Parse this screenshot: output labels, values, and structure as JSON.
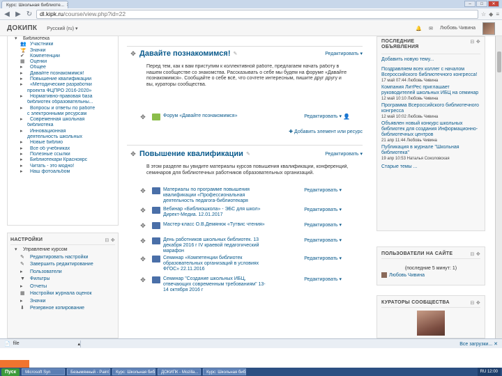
{
  "browser": {
    "tab_title": "Курс: Школьная библиоте...",
    "address_domain": "dl.kipk.ru",
    "address_path": "/course/view.php?id=22",
    "back_icon": "back-arrow-icon",
    "forward_icon": "forward-arrow-icon",
    "reload_icon": "reload-icon"
  },
  "header": {
    "brand": "ДОКИПК",
    "language": "Русский (ru) ▾",
    "user_name": "Любовь Чивина"
  },
  "nav": {
    "items": [
      {
        "label": "Библиотека",
        "level": "top",
        "icon": "▾"
      },
      {
        "label": "Участники",
        "level": "child",
        "icon": "👥"
      },
      {
        "label": "Значки",
        "level": "child",
        "icon": "🏆"
      },
      {
        "label": "Компетенции",
        "level": "child",
        "icon": "✔"
      },
      {
        "label": "Оценки",
        "level": "child",
        "icon": "▦"
      },
      {
        "label": "Общее",
        "level": "child",
        "icon": "▸"
      },
      {
        "label": "Давайте познакомимся!",
        "level": "child",
        "icon": "▸"
      },
      {
        "label": "Повышение квалификации",
        "level": "child",
        "icon": "▸"
      },
      {
        "label": "«Методические разработки",
        "level": "child",
        "icon": "▸"
      },
      {
        "label": "проекта ФЦПРО 2016-2020»",
        "level": "sub",
        "icon": ""
      },
      {
        "label": "Нормативно-правовая база",
        "level": "child",
        "icon": "▸"
      },
      {
        "label": "библиотек образовательны...",
        "level": "sub",
        "icon": ""
      },
      {
        "label": "Вопросы и ответы по работе",
        "level": "child",
        "icon": "▸"
      },
      {
        "label": "с электронными ресурсам",
        "level": "sub",
        "icon": ""
      },
      {
        "label": "Современная школьная",
        "level": "child",
        "icon": "▸"
      },
      {
        "label": "библиотека",
        "level": "sub",
        "icon": ""
      },
      {
        "label": "Инновационная",
        "level": "child",
        "icon": "▸"
      },
      {
        "label": "деятельность школьных",
        "level": "sub",
        "icon": ""
      },
      {
        "label": "Новые библио",
        "level": "child",
        "icon": "▸"
      },
      {
        "label": "Все об учебниках",
        "level": "child",
        "icon": "▸"
      },
      {
        "label": "Полезные ссылки",
        "level": "child",
        "icon": "▸"
      },
      {
        "label": "Библиотекари Красноярс",
        "level": "child",
        "icon": "▸"
      },
      {
        "label": "Читать - это модно!",
        "level": "child",
        "icon": "▸"
      },
      {
        "label": "Наш фотоальбом",
        "level": "child",
        "icon": "▸"
      }
    ]
  },
  "settings": {
    "title": "НАСТРОЙКИ",
    "controls": "⊟ ✥",
    "items": [
      {
        "label": "Управление курсом",
        "icon": "▾",
        "level": "top"
      },
      {
        "label": "Редактировать настройки",
        "icon": "✎",
        "level": "child"
      },
      {
        "label": "Завершить редактирование",
        "icon": "✎",
        "level": "child"
      },
      {
        "label": "Пользователи",
        "icon": "▸",
        "level": "child"
      },
      {
        "label": "Фильтры",
        "icon": "▼",
        "level": "child"
      },
      {
        "label": "Отчеты",
        "icon": "▸",
        "level": "child"
      },
      {
        "label": "Настройки журнала оценок",
        "icon": "▦",
        "level": "child"
      },
      {
        "label": "Значки",
        "icon": "▸",
        "level": "child"
      },
      {
        "label": "Резервное копирование",
        "icon": "⬇",
        "level": "child"
      }
    ]
  },
  "sections": {
    "intro": {
      "title": "Давайте познакомимся!",
      "edit": "Редактировать ▾",
      "summary": "Перед тем, как к вам приступим к коллективной работе, предлагаем начать работу в нашем сообществе со знакомства. Рассказывать о себе мы будем на форуме «Давайте познакомимся». Сообщайте о себе всё, что сочтете интересным, пишите друг другу и вы, кураторы сообщества.",
      "activity": "Форум «Давайте познакомимся»",
      "activity_edit": "Редактировать ▾",
      "add": "✚ Добавить элемент или ресурс"
    },
    "training": {
      "title": "Повышение квалификации",
      "edit": "Редактировать ▾",
      "summary": "В этом разделе вы увидите материалы курсов повышения квалификации, конференций, семинаров для библиотечных работников образовательных организаций.",
      "activities": [
        {
          "text": "Материалы по программе повышения квалификации «Профессиональная деятельность педагога-библиотекаря",
          "edit": "Редактировать ▾"
        },
        {
          "text": "Вебинар «Библиошкола» - ЭБС для школ» Директ-Медиа. 12.01.2017",
          "edit": "Редактировать ▾"
        },
        {
          "text": "Мастер-класс О.В.Демянюк «Тутвис чтения»",
          "edit": "Редактировать ▾"
        },
        {
          "text": "День работников школьных библиотек. 13 декабря 2016 г IV краевой педагогический марафон",
          "edit": "Редактировать ▾"
        },
        {
          "text": "Семинар «Компетенции библиотек образовательных организаций в условиях ФГОС» 22.11.2016",
          "edit": "Редактировать ▾"
        },
        {
          "text": "Семинар \"Создание школьных ИБЦ, отвечающих современным требованиям\" 13-14 октября 2016 г",
          "edit": "Редактировать ▾"
        }
      ]
    }
  },
  "news": {
    "title": "ПОСЛЕДНИЕ ОБЪЯВЛЕНИЯ",
    "controls": "⊟ ✥",
    "add_topic": "Добавить новую тему...",
    "items": [
      {
        "link": "Поздравляем всех коллег с началом Всероссийского библиотечного конгресса!",
        "meta": "17 май 07:44 Любовь Чивина"
      },
      {
        "link": "Компания ЛитРес приглашает руководителей школьных ИБЦ на семинар",
        "meta": "12 май 10:10 Любовь Чивина"
      },
      {
        "link": "Программа Всероссийского библиотечного конгресса",
        "meta": "12 май 10:02 Любовь Чивина"
      },
      {
        "link": "Объявлен новый конкурс школьных библиотек для создания Информационно-библиотечных центров",
        "meta": "21 апр 11:44 Любовь Чивина"
      },
      {
        "link": "Публикация в журнале \"Школьная библиотека\"",
        "meta": "19 апр 10:53 Наталья Соколовская"
      }
    ],
    "old": "Старые темы ..."
  },
  "online": {
    "title": "ПОЛЬЗОВАТЕЛИ НА САЙТЕ",
    "controls": "⊟ ✥",
    "subtitle": "(последние 5 минут: 1)",
    "user": "Любовь Чивина"
  },
  "curators": {
    "title": "КУРАТОРЫ СООБЩЕСТВА",
    "controls": "⊟ ✥"
  },
  "download": {
    "file": "file",
    "show_all": "Все загрузки... ✕"
  },
  "taskbar": {
    "start": "Пуск",
    "items": [
      "Microsoft Syn",
      "Безымянный - Paint",
      "Курс: Школьная библ...",
      "ДОКИПК - Mozilla...",
      "Курс: Школьная библ..."
    ],
    "clock": "RU 12:00"
  },
  "colors": {
    "link": "#0a5a8c",
    "taskbar": "#2c4f82",
    "accent_orange": "#f0742f"
  }
}
